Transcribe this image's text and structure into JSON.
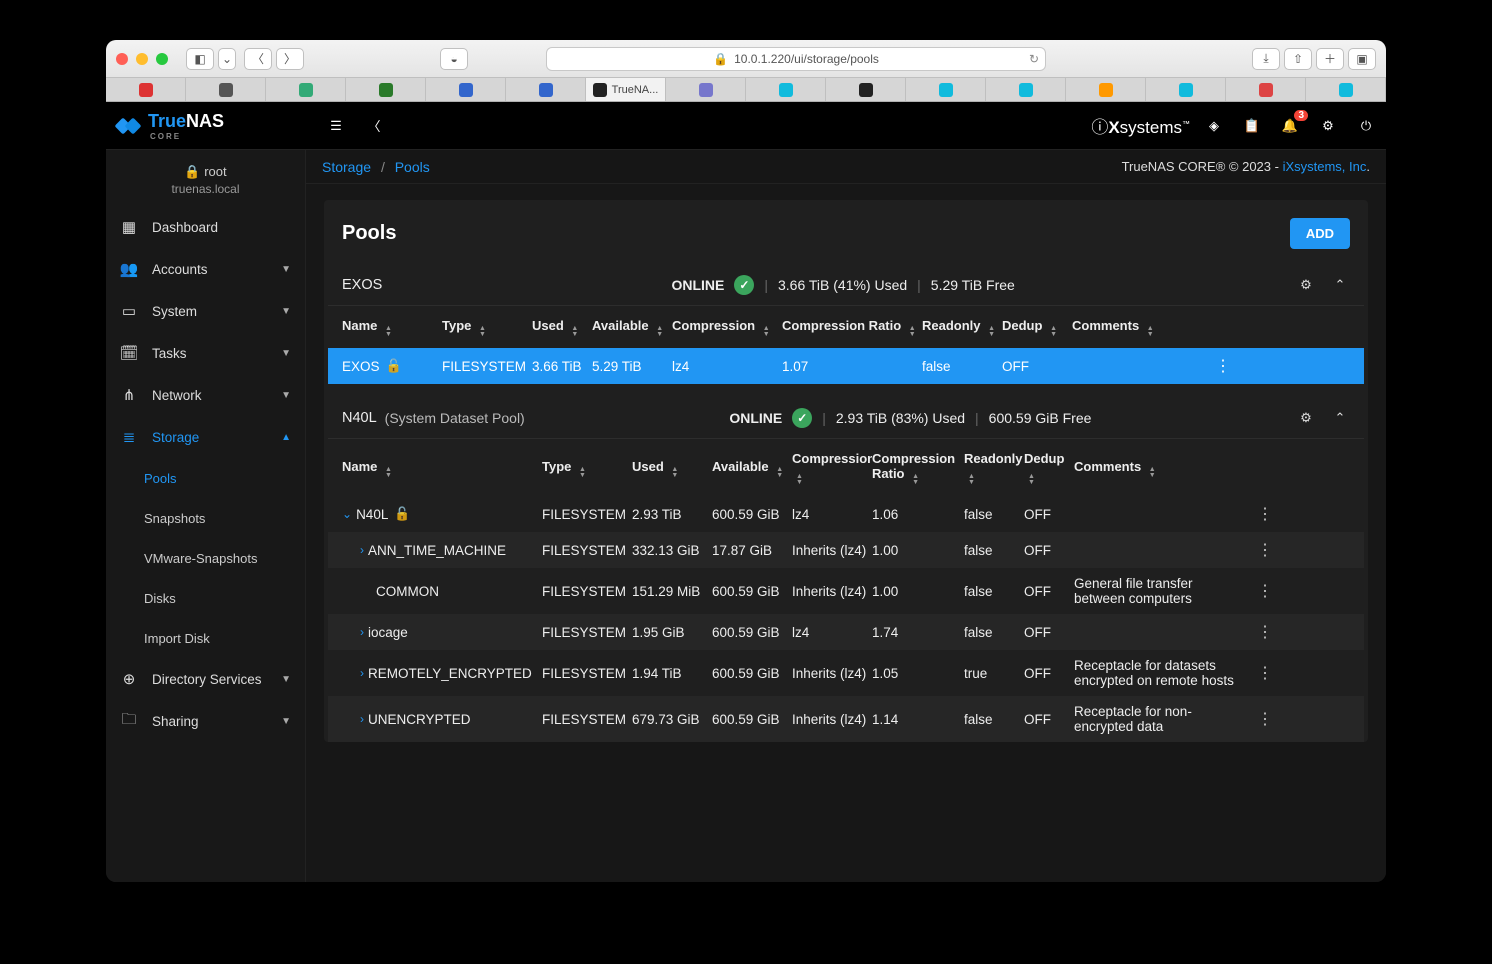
{
  "browser": {
    "url": "10.0.1.220/ui/storage/pools",
    "active_tab": "TrueNA...",
    "tab_icons": [
      "R",
      "RN",
      "◯",
      "Gp",
      "◍",
      "◍",
      "◈",
      "B",
      "◆",
      "⊙",
      "◆",
      "◍",
      "a",
      "▦",
      "◉",
      "◆"
    ]
  },
  "header": {
    "brand_blue": "True",
    "brand_white": "NAS",
    "brand_sub": "CORE",
    "ix": "iXsystems",
    "notif_badge": "3"
  },
  "sidebar": {
    "user": "root",
    "host": "truenas.local",
    "items": [
      {
        "label": "Dashboard",
        "icon": "▦"
      },
      {
        "label": "Accounts",
        "icon": "👥",
        "exp": true
      },
      {
        "label": "System",
        "icon": "▭",
        "exp": true
      },
      {
        "label": "Tasks",
        "icon": "🗓",
        "exp": true
      },
      {
        "label": "Network",
        "icon": "⋔",
        "exp": true
      },
      {
        "label": "Storage",
        "icon": "≣",
        "exp": true,
        "active": true,
        "children": [
          {
            "label": "Pools",
            "active": true
          },
          {
            "label": "Snapshots"
          },
          {
            "label": "VMware-Snapshots"
          },
          {
            "label": "Disks"
          },
          {
            "label": "Import Disk"
          }
        ]
      },
      {
        "label": "Directory Services",
        "icon": "⊕",
        "exp": true
      },
      {
        "label": "Sharing",
        "icon": "🗀",
        "exp": true
      }
    ]
  },
  "crumbs": {
    "a": "Storage",
    "b": "Pools",
    "right_a": "TrueNAS CORE® © 2023 - ",
    "right_b": "iXsystems, Inc",
    "right_c": "."
  },
  "panel": {
    "title": "Pools",
    "add": "ADD"
  },
  "cols": [
    "Name",
    "Type",
    "Used",
    "Available",
    "Compression",
    "Compression Ratio",
    "Readonly",
    "Dedup",
    "Comments"
  ],
  "pools": [
    {
      "name": "EXOS",
      "note": "",
      "status": "ONLINE",
      "used": "3.66 TiB (41%) Used",
      "free": "5.29 TiB Free",
      "grid": "grid1",
      "rows": [
        {
          "sel": true,
          "depth": 0,
          "locked": true,
          "name": "EXOS",
          "type": "FILESYSTEM",
          "used": "3.66 TiB",
          "avail": "5.29 TiB",
          "comp": "lz4",
          "ratio": "1.07",
          "ro": "false",
          "dedup": "OFF",
          "comm": ""
        }
      ]
    },
    {
      "name": "N40L",
      "note": "(System Dataset Pool)",
      "status": "ONLINE",
      "used": "2.93 TiB (83%) Used",
      "free": "600.59 GiB Free",
      "grid": "grid2",
      "rows": [
        {
          "depth": 0,
          "open": true,
          "locked": true,
          "name": "N40L",
          "type": "FILESYSTEM",
          "used": "2.93 TiB",
          "avail": "600.59 GiB",
          "comp": "lz4",
          "ratio": "1.06",
          "ro": "false",
          "dedup": "OFF",
          "comm": ""
        },
        {
          "alt": true,
          "depth": 1,
          "exp": true,
          "name": "ANN_TIME_MACHINE",
          "type": "FILESYSTEM",
          "used": "332.13 GiB",
          "avail": "17.87 GiB",
          "comp": "Inherits (lz4)",
          "ratio": "1.00",
          "ro": "false",
          "dedup": "OFF",
          "comm": ""
        },
        {
          "depth": 2,
          "name": "COMMON",
          "type": "FILESYSTEM",
          "used": "151.29 MiB",
          "avail": "600.59 GiB",
          "comp": "Inherits (lz4)",
          "ratio": "1.00",
          "ro": "false",
          "dedup": "OFF",
          "comm": "General file transfer between computers"
        },
        {
          "alt": true,
          "depth": 1,
          "exp": true,
          "name": "iocage",
          "type": "FILESYSTEM",
          "used": "1.95 GiB",
          "avail": "600.59 GiB",
          "comp": "lz4",
          "ratio": "1.74",
          "ro": "false",
          "dedup": "OFF",
          "comm": ""
        },
        {
          "depth": 1,
          "exp": true,
          "name": "REMOTELY_ENCRYPTED",
          "type": "FILESYSTEM",
          "used": "1.94 TiB",
          "avail": "600.59 GiB",
          "comp": "Inherits (lz4)",
          "ratio": "1.05",
          "ro": "true",
          "dedup": "OFF",
          "comm": "Receptacle for datasets encrypted on remote hosts"
        },
        {
          "alt": true,
          "depth": 1,
          "exp": true,
          "name": "UNENCRYPTED",
          "type": "FILESYSTEM",
          "used": "679.73 GiB",
          "avail": "600.59 GiB",
          "comp": "Inherits (lz4)",
          "ratio": "1.14",
          "ro": "false",
          "dedup": "OFF",
          "comm": "Receptacle for non-encrypted data"
        }
      ]
    }
  ]
}
